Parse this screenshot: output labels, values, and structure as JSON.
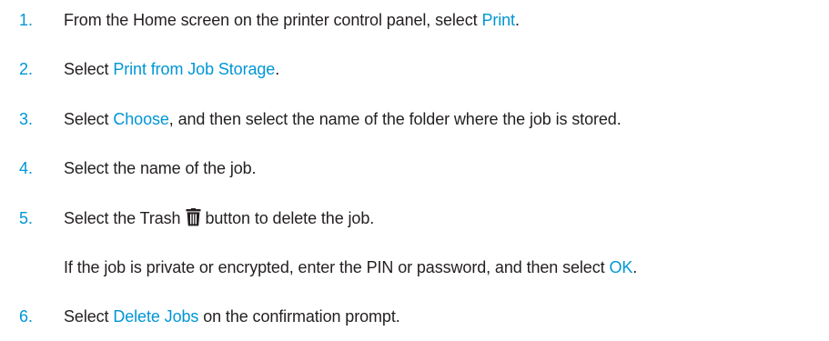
{
  "steps": [
    {
      "number": "1.",
      "text_before": "From the Home screen on the printer control panel, select ",
      "link": "Print",
      "text_after": "."
    },
    {
      "number": "2.",
      "text_before": "Select ",
      "link": "Print from Job Storage",
      "text_after": "."
    },
    {
      "number": "3.",
      "text_before": "Select ",
      "link": "Choose",
      "text_after": ", and then select the name of the folder where the job is stored."
    },
    {
      "number": "4.",
      "text": "Select the name of the job."
    },
    {
      "number": "5.",
      "text_before": "Select the Trash",
      "icon": "trash-icon",
      "text_after": "button to delete the job.",
      "note_before": "If the job is private or encrypted, enter the PIN or password, and then select ",
      "note_link": "OK",
      "note_after": "."
    },
    {
      "number": "6.",
      "text_before": "Select ",
      "link": "Delete Jobs",
      "text_after": " on the confirmation prompt."
    }
  ],
  "colors": {
    "accent": "#0096d6",
    "text": "#231f20"
  }
}
